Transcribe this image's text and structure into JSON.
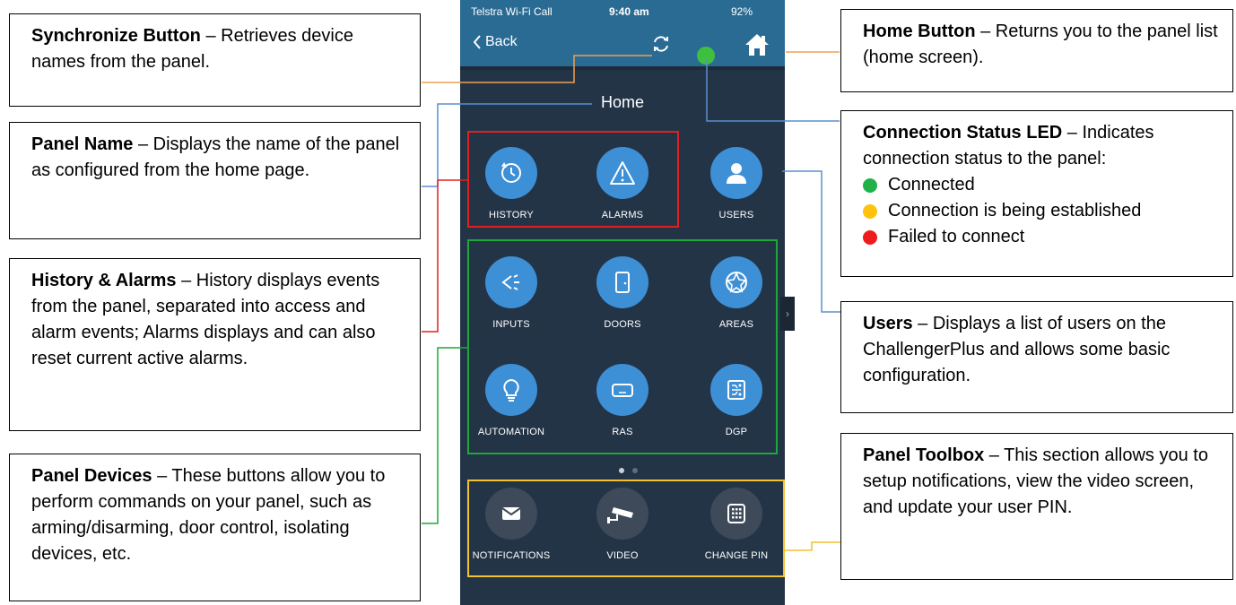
{
  "callouts": {
    "synchronize": {
      "title": "Synchronize Button",
      "text": " – Retrieves device names from the panel."
    },
    "panel_name": {
      "title": "Panel Name",
      "text": " – Displays the name of the panel as configured from the home page."
    },
    "history_alarms": {
      "title": "History & Alarms",
      "text": " – History displays events from the panel, separated into access and alarm events; Alarms displays and can also reset current active alarms."
    },
    "panel_devices": {
      "title": "Panel Devices",
      "text": " – These buttons allow you to perform commands on your panel, such as arming/disarming, door control, isolating devices, etc."
    },
    "home_button": {
      "title": "Home Button",
      "text": " – Returns you to the panel list (home screen)."
    },
    "connection_led": {
      "title": "Connection Status LED",
      "text": " – Indicates connection status to the panel:",
      "statuses": [
        {
          "label": "Connected",
          "color": "#21b14a"
        },
        {
          "label": "Connection is being established",
          "color": "#ffc20e"
        },
        {
          "label": "Failed to connect",
          "color": "#ee1c1c"
        }
      ]
    },
    "users": {
      "title": "Users",
      "text": " – Displays a list of users on the ChallengerPlus and allows some basic configuration."
    },
    "toolbox": {
      "title": "Panel Toolbox",
      "text": " – This section allows you to setup notifications, view the video screen, and update your user PIN."
    }
  },
  "phone": {
    "status_bar": {
      "carrier": "Telstra Wi-Fi Call",
      "time": "9:40 am",
      "battery": "92%"
    },
    "back_label": "Back",
    "title": "Home",
    "led_color": "#3fbf3f",
    "tiles": {
      "history": "HISTORY",
      "alarms": "ALARMS",
      "users": "USERS",
      "inputs": "INPUTS",
      "doors": "DOORS",
      "areas": "AREAS",
      "automation": "AUTOMATION",
      "ras": "RAS",
      "dgp": "DGP",
      "notifications": "NOTIFICATIONS",
      "video": "VIDEO",
      "change_pin": "CHANGE PIN"
    }
  },
  "colors": {
    "history_frame": "#e02020",
    "devices_frame": "#1fa83a",
    "toolbox_frame": "#f2c12e",
    "tile_blue": "#3d8fd6",
    "nav_blue": "#2a6b94"
  }
}
